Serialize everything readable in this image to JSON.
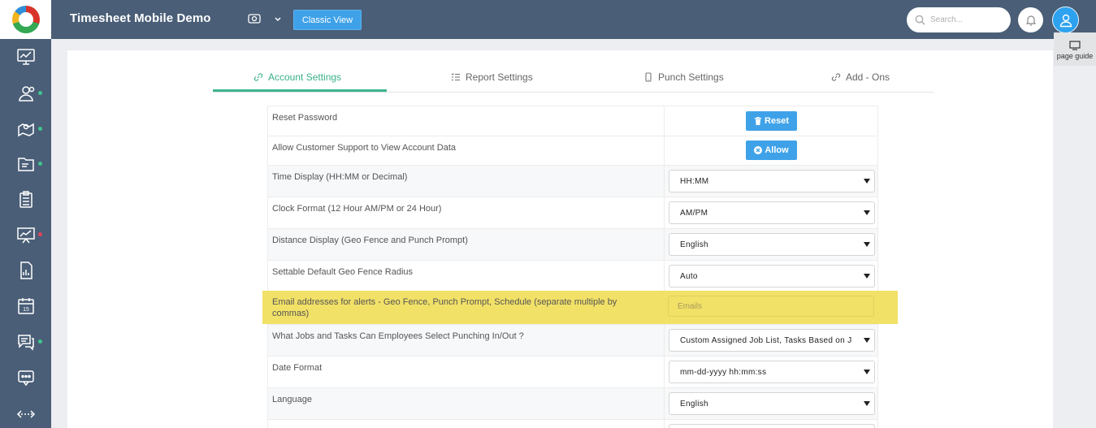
{
  "app": {
    "title": "Timesheet Mobile Demo",
    "classic_view": "Classic View"
  },
  "header": {
    "search_placeholder": "Search...",
    "page_guide": "page guide"
  },
  "sidebar": {
    "items": [
      {
        "icon": "dashboard-chart-icon",
        "dot": false
      },
      {
        "icon": "employees-icon",
        "dot": "green"
      },
      {
        "icon": "map-location-icon",
        "dot": "green"
      },
      {
        "icon": "folder-icon",
        "dot": "green"
      },
      {
        "icon": "clipboard-list-icon",
        "dot": false
      },
      {
        "icon": "presentation-chart-icon",
        "dot": "red"
      },
      {
        "icon": "report-document-icon",
        "dot": false
      },
      {
        "icon": "calendar-icon",
        "dot": false
      },
      {
        "icon": "chat-icon",
        "dot": "green"
      },
      {
        "icon": "message-dots-icon",
        "dot": false
      },
      {
        "icon": "arrows-horizontal-icon",
        "dot": false
      }
    ],
    "calendar_day": "15"
  },
  "tabs": [
    {
      "label": "Account Settings",
      "icon": "link-icon",
      "active": true
    },
    {
      "label": "Report Settings",
      "icon": "list-icon",
      "active": false
    },
    {
      "label": "Punch Settings",
      "icon": "phone-icon",
      "active": false
    },
    {
      "label": "Add - Ons",
      "icon": "link-icon",
      "active": false
    }
  ],
  "settings": {
    "reset_password": {
      "label": "Reset Password",
      "button": "Reset"
    },
    "allow_support": {
      "label": "Allow Customer Support to View Account Data",
      "button": "Allow"
    },
    "time_display": {
      "label": "Time Display (HH:MM or Decimal)",
      "value": "HH:MM"
    },
    "clock_format": {
      "label": "Clock Format (12 Hour AM/PM or 24 Hour)",
      "value": "AM/PM"
    },
    "distance_display": {
      "label": "Distance Display (Geo Fence and Punch Prompt)",
      "value": "English"
    },
    "geo_fence_radius": {
      "label": "Settable Default Geo Fence Radius",
      "value": "Auto"
    },
    "email_alerts": {
      "label": "Email addresses for alerts - Geo Fence, Punch Prompt, Schedule (separate multiple by commas)",
      "placeholder": "Emails"
    },
    "jobs_tasks": {
      "label": "What Jobs and Tasks Can Employees Select Punching In/Out ?",
      "value": "Custom Assigned Job List, Tasks Based on Jo"
    },
    "date_format": {
      "label": "Date Format",
      "value": "mm-dd-yyyy hh:mm:ss"
    },
    "language": {
      "label": "Language",
      "value": "English"
    }
  },
  "colors": {
    "sidebar": "#4a5e77",
    "accent_green": "#3db58f",
    "button_blue": "#3fa2e9",
    "highlight": "#f2e167"
  }
}
